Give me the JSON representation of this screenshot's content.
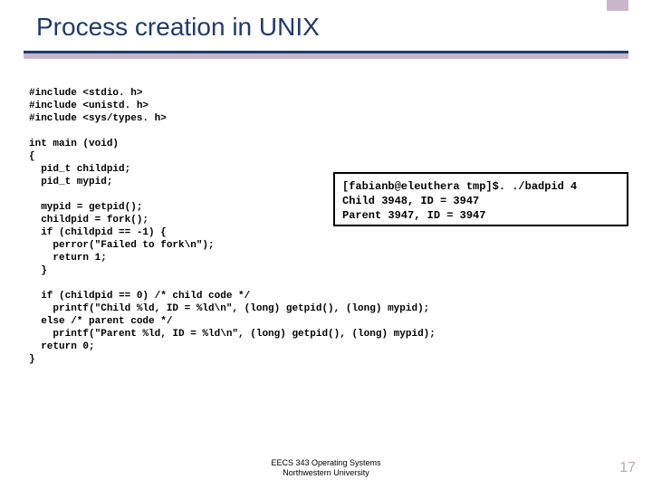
{
  "title": "Process creation in UNIX",
  "code": "#include <stdio. h>\n#include <unistd. h>\n#include <sys/types. h>\n\nint main (void)\n{\n  pid_t childpid;\n  pid_t mypid;\n\n  mypid = getpid();\n  childpid = fork();\n  if (childpid == -1) {\n    perror(\"Failed to fork\\n\");\n    return 1;\n  }\n\n  if (childpid == 0) /* child code */\n    printf(\"Child %ld, ID = %ld\\n\", (long) getpid(), (long) mypid);\n  else /* parent code */\n    printf(\"Parent %ld, ID = %ld\\n\", (long) getpid(), (long) mypid);\n  return 0;\n}",
  "output": "[fabianb@eleuthera tmp]$. ./badpid 4\nChild 3948, ID = 3947\nParent 3947, ID = 3947",
  "footer_line1": "EECS 343 Operating Systems",
  "footer_line2": "Northwestern University",
  "page_number": "17"
}
